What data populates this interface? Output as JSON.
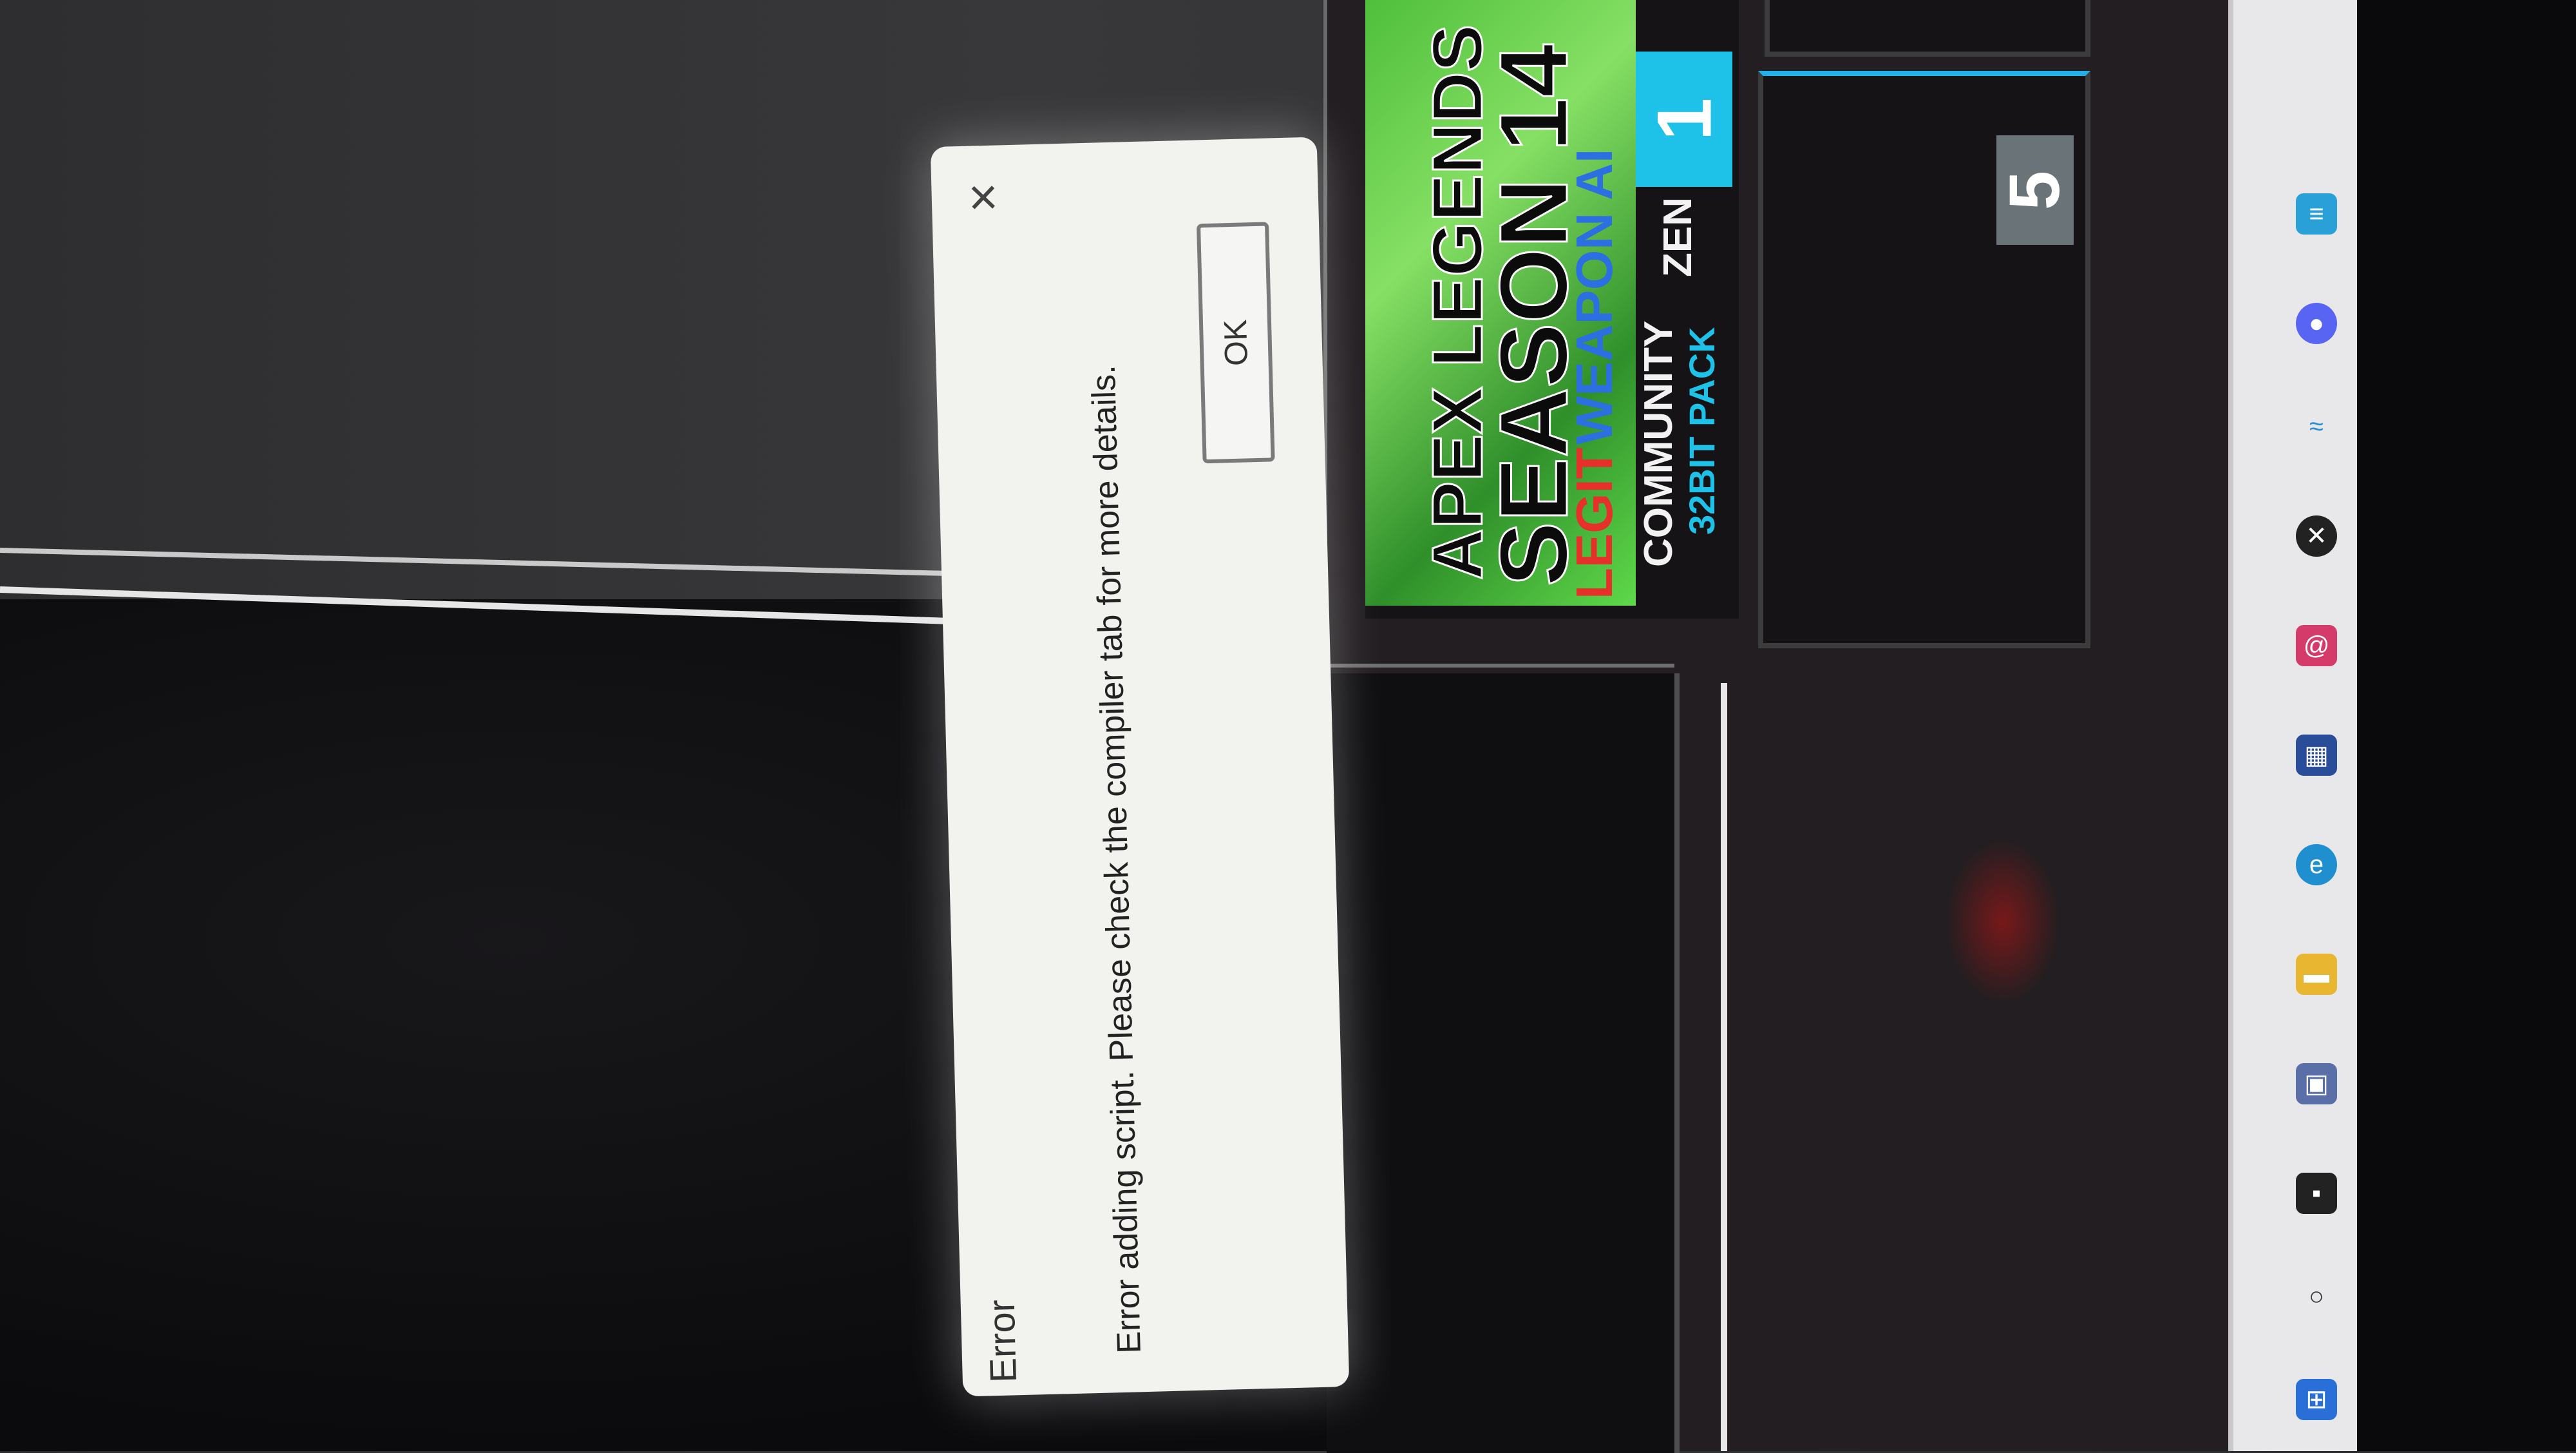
{
  "dialog": {
    "title": "Error",
    "message": "Error adding script. Please check the compiler tab for more details.",
    "ok_label": "OK",
    "close_symbol": "×"
  },
  "slots": [
    {
      "number": "1",
      "art_lines": [
        "APEX LEGENDS",
        "SEASON 14",
        "LEGIT WEAPON AI"
      ],
      "art_legit": "LEGIT",
      "art_weapon": "WEAPON AI",
      "footer_left": "COMMUNITY",
      "footer_right": "ZEN",
      "footer_sub": "32BIT PACK"
    },
    {
      "number": "5"
    }
  ],
  "taskbar_icons": [
    "windows-start-icon",
    "search-icon",
    "task-view-icon",
    "file-explorer-icon",
    "folder-icon",
    "edge-icon",
    "store-icon",
    "mail-icon",
    "xbox-icon",
    "app-icon",
    "discord-icon",
    "notepad-icon"
  ],
  "colors": {
    "accent_cyan": "#1ec1e8",
    "art_green": "#5fd94a",
    "legit_red": "#e5312a",
    "weapon_blue": "#2c6fe0"
  }
}
